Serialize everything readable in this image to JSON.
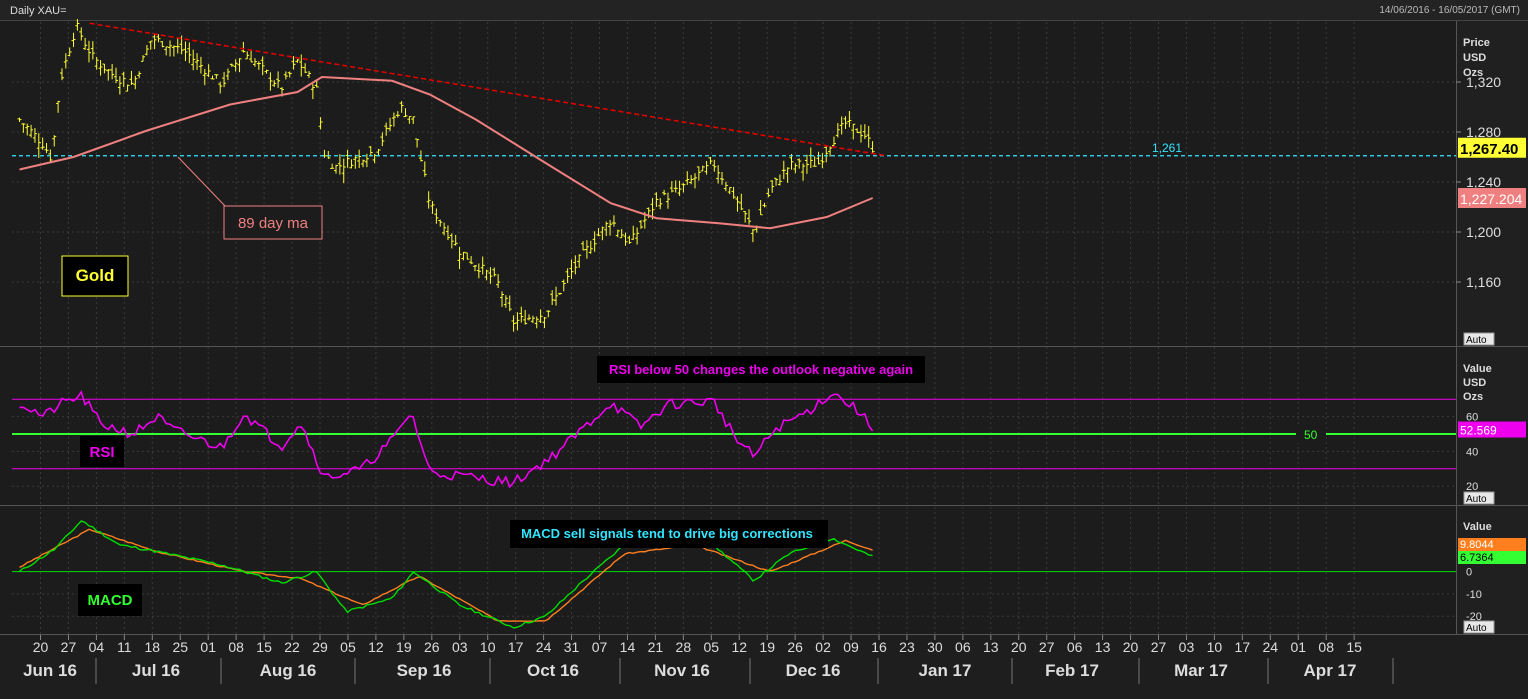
{
  "header": {
    "left_title": "Daily XAU=",
    "right_range": "14/06/2016 - 16/05/2017 (GMT)"
  },
  "colors": {
    "background": "#1c1c1c",
    "grid": "#3a3a3a",
    "price_bars": "#ffff33",
    "moving_average": "#f08080",
    "trendline": "#e00000",
    "support_line": "#33e5ff",
    "rsi_line": "#ee00ee",
    "rsi_fifty": "#33ff33",
    "macd_line": "#00dd00",
    "signal_line": "#ff7f1f"
  },
  "x_axis": {
    "day_ticks": [
      "20",
      "27",
      "04",
      "11",
      "18",
      "25",
      "01",
      "08",
      "15",
      "22",
      "29",
      "05",
      "12",
      "19",
      "26",
      "03",
      "10",
      "17",
      "24",
      "31",
      "07",
      "14",
      "21",
      "28",
      "05",
      "12",
      "19",
      "26",
      "02",
      "09",
      "16",
      "23",
      "30",
      "06",
      "13",
      "20",
      "27",
      "06",
      "13",
      "20",
      "27",
      "03",
      "10",
      "17",
      "24",
      "01",
      "08",
      "15"
    ],
    "month_labels": [
      "Jun 16",
      "Jul 16",
      "Aug 16",
      "Sep 16",
      "Oct 16",
      "Nov 16",
      "Dec 16",
      "Jan 17",
      "Feb 17",
      "Mar 17",
      "Apr 17"
    ]
  },
  "price_panel": {
    "axis_title": [
      "Price",
      "USD",
      "Ozs"
    ],
    "y_tick_labels": [
      "1,320",
      "1,280",
      "1,240",
      "1,200",
      "1,160"
    ],
    "last_price_tag": "1,267.40",
    "ma_value_tag": "1,227.204",
    "support_label": "1,261",
    "ma_annotation": "89 day ma",
    "asset_label": "Gold",
    "auto_button": "Auto"
  },
  "rsi_panel": {
    "axis_title": [
      "Value",
      "USD",
      "Ozs"
    ],
    "y_tick_labels": [
      "60",
      "40",
      "20"
    ],
    "value_tag": "52.569",
    "fifty_label": "50",
    "annotation": "RSI below 50 changes the outlook negative again",
    "panel_label": "RSI",
    "auto_button": "Auto"
  },
  "macd_panel": {
    "axis_title": "Value",
    "y_tick_labels": [
      "0",
      "-10",
      "-20"
    ],
    "macd_tag": "9.8044",
    "signal_tag": "6.7364",
    "annotation": "MACD sell signals tend to drive big corrections",
    "panel_label": "MACD",
    "auto_button": "Auto"
  },
  "chart_data": [
    {
      "type": "ohlc",
      "title": "Daily XAU=",
      "ylabel": "Price USD Ozs",
      "ylim": [
        1112,
        1364
      ],
      "approx_close_path": [
        {
          "date": "2016-06-15",
          "value": 1290
        },
        {
          "date": "2016-06-24",
          "value": 1270
        },
        {
          "date": "2016-06-27",
          "value": 1258
        },
        {
          "date": "2016-06-30",
          "value": 1320
        },
        {
          "date": "2016-07-06",
          "value": 1365
        },
        {
          "date": "2016-07-12",
          "value": 1340
        },
        {
          "date": "2016-07-20",
          "value": 1325
        },
        {
          "date": "2016-07-27",
          "value": 1318
        },
        {
          "date": "2016-08-03",
          "value": 1355
        },
        {
          "date": "2016-08-15",
          "value": 1345
        },
        {
          "date": "2016-08-29",
          "value": 1318
        },
        {
          "date": "2016-09-06",
          "value": 1345
        },
        {
          "date": "2016-09-20",
          "value": 1315
        },
        {
          "date": "2016-09-26",
          "value": 1337
        },
        {
          "date": "2016-10-03",
          "value": 1315
        },
        {
          "date": "2016-10-06",
          "value": 1262
        },
        {
          "date": "2016-10-10",
          "value": 1252
        },
        {
          "date": "2016-10-25",
          "value": 1265
        },
        {
          "date": "2016-11-03",
          "value": 1300
        },
        {
          "date": "2016-11-08",
          "value": 1290
        },
        {
          "date": "2016-11-10",
          "value": 1265
        },
        {
          "date": "2016-11-14",
          "value": 1222
        },
        {
          "date": "2016-11-25",
          "value": 1185
        },
        {
          "date": "2016-12-09",
          "value": 1160
        },
        {
          "date": "2016-12-15",
          "value": 1128
        },
        {
          "date": "2016-12-27",
          "value": 1135
        },
        {
          "date": "2017-01-09",
          "value": 1180
        },
        {
          "date": "2017-01-20",
          "value": 1210
        },
        {
          "date": "2017-01-27",
          "value": 1190
        },
        {
          "date": "2017-02-06",
          "value": 1225
        },
        {
          "date": "2017-02-14",
          "value": 1233
        },
        {
          "date": "2017-02-27",
          "value": 1255
        },
        {
          "date": "2017-03-07",
          "value": 1228
        },
        {
          "date": "2017-03-14",
          "value": 1200
        },
        {
          "date": "2017-03-20",
          "value": 1233
        },
        {
          "date": "2017-03-27",
          "value": 1253
        },
        {
          "date": "2017-04-07",
          "value": 1255
        },
        {
          "date": "2017-04-11",
          "value": 1270
        },
        {
          "date": "2017-04-17",
          "value": 1287
        },
        {
          "date": "2017-04-24",
          "value": 1278
        },
        {
          "date": "2017-04-27",
          "value": 1267.4
        }
      ],
      "moving_average_89": [
        {
          "date": "2016-06-15",
          "value": 1250
        },
        {
          "date": "2016-07-05",
          "value": 1260
        },
        {
          "date": "2016-08-01",
          "value": 1281
        },
        {
          "date": "2016-09-01",
          "value": 1302
        },
        {
          "date": "2016-09-26",
          "value": 1312
        },
        {
          "date": "2016-10-05",
          "value": 1324
        },
        {
          "date": "2016-10-31",
          "value": 1321
        },
        {
          "date": "2016-11-14",
          "value": 1310
        },
        {
          "date": "2016-12-01",
          "value": 1290
        },
        {
          "date": "2016-12-27",
          "value": 1255
        },
        {
          "date": "2017-01-20",
          "value": 1223
        },
        {
          "date": "2017-02-06",
          "value": 1211
        },
        {
          "date": "2017-03-01",
          "value": 1207
        },
        {
          "date": "2017-03-20",
          "value": 1203
        },
        {
          "date": "2017-04-10",
          "value": 1212
        },
        {
          "date": "2017-04-27",
          "value": 1227.2
        }
      ],
      "trendline": [
        {
          "date": "2016-07-11",
          "value": 1367
        },
        {
          "date": "2017-05-02",
          "value": 1261
        }
      ],
      "support_level": 1261,
      "last_value": 1267.4,
      "ma_last_value": 1227.204
    },
    {
      "type": "line",
      "title": "RSI below 50 changes the outlook negative again",
      "ylim": [
        0,
        100
      ],
      "reference_lines": [
        70,
        50,
        30
      ],
      "series": [
        {
          "name": "RSI",
          "values": [
            {
              "date": "2016-06-15",
              "value": 68
            },
            {
              "date": "2016-06-24",
              "value": 60
            },
            {
              "date": "2016-06-30",
              "value": 67
            },
            {
              "date": "2016-07-08",
              "value": 72
            },
            {
              "date": "2016-07-15",
              "value": 56
            },
            {
              "date": "2016-07-27",
              "value": 50
            },
            {
              "date": "2016-08-05",
              "value": 60
            },
            {
              "date": "2016-08-10",
              "value": 53
            },
            {
              "date": "2016-08-29",
              "value": 42
            },
            {
              "date": "2016-09-06",
              "value": 62
            },
            {
              "date": "2016-09-20",
              "value": 43
            },
            {
              "date": "2016-09-27",
              "value": 57
            },
            {
              "date": "2016-10-06",
              "value": 25
            },
            {
              "date": "2016-10-20",
              "value": 30
            },
            {
              "date": "2016-11-01",
              "value": 48
            },
            {
              "date": "2016-11-07",
              "value": 63
            },
            {
              "date": "2016-11-14",
              "value": 28
            },
            {
              "date": "2016-11-25",
              "value": 26
            },
            {
              "date": "2016-12-15",
              "value": 22
            },
            {
              "date": "2016-12-30",
              "value": 38
            },
            {
              "date": "2017-01-09",
              "value": 52
            },
            {
              "date": "2017-01-20",
              "value": 68
            },
            {
              "date": "2017-01-31",
              "value": 54
            },
            {
              "date": "2017-02-10",
              "value": 67
            },
            {
              "date": "2017-02-27",
              "value": 69
            },
            {
              "date": "2017-03-08",
              "value": 46
            },
            {
              "date": "2017-03-14",
              "value": 37
            },
            {
              "date": "2017-03-22",
              "value": 53
            },
            {
              "date": "2017-04-03",
              "value": 63
            },
            {
              "date": "2017-04-12",
              "value": 74
            },
            {
              "date": "2017-04-22",
              "value": 63
            },
            {
              "date": "2017-04-27",
              "value": 52.569
            }
          ]
        }
      ],
      "last_value": 52.569
    },
    {
      "type": "line",
      "title": "MACD sell signals tend to drive big corrections",
      "ylim": [
        -28,
        25
      ],
      "series": [
        {
          "name": "MACD",
          "values": [
            {
              "date": "2016-06-15",
              "value": 0
            },
            {
              "date": "2016-06-28",
              "value": 10
            },
            {
              "date": "2016-07-08",
              "value": 23
            },
            {
              "date": "2016-07-22",
              "value": 12
            },
            {
              "date": "2016-08-01",
              "value": 10
            },
            {
              "date": "2016-08-29",
              "value": 3
            },
            {
              "date": "2016-09-20",
              "value": -5
            },
            {
              "date": "2016-10-03",
              "value": 0
            },
            {
              "date": "2016-10-14",
              "value": -18
            },
            {
              "date": "2016-10-31",
              "value": -12
            },
            {
              "date": "2016-11-08",
              "value": 0
            },
            {
              "date": "2016-11-25",
              "value": -15
            },
            {
              "date": "2016-12-15",
              "value": -25
            },
            {
              "date": "2016-12-27",
              "value": -20
            },
            {
              "date": "2017-01-09",
              "value": -5
            },
            {
              "date": "2017-01-25",
              "value": 12
            },
            {
              "date": "2017-02-10",
              "value": 13
            },
            {
              "date": "2017-02-27",
              "value": 12
            },
            {
              "date": "2017-03-14",
              "value": -4
            },
            {
              "date": "2017-03-27",
              "value": 8
            },
            {
              "date": "2017-04-12",
              "value": 15
            },
            {
              "date": "2017-04-27",
              "value": 6.7364
            }
          ]
        },
        {
          "name": "Signal",
          "values": [
            {
              "date": "2016-06-15",
              "value": 2
            },
            {
              "date": "2016-07-11",
              "value": 19
            },
            {
              "date": "2016-08-05",
              "value": 9
            },
            {
              "date": "2016-09-06",
              "value": 0
            },
            {
              "date": "2016-09-27",
              "value": -3
            },
            {
              "date": "2016-10-20",
              "value": -15
            },
            {
              "date": "2016-11-10",
              "value": -2
            },
            {
              "date": "2016-12-09",
              "value": -22
            },
            {
              "date": "2016-12-27",
              "value": -22
            },
            {
              "date": "2017-01-25",
              "value": 8
            },
            {
              "date": "2017-02-20",
              "value": 12
            },
            {
              "date": "2017-03-20",
              "value": 0
            },
            {
              "date": "2017-04-17",
              "value": 14
            },
            {
              "date": "2017-04-27",
              "value": 9.8044
            }
          ]
        }
      ],
      "last_values": {
        "MACD": 6.7364,
        "Signal": 9.8044
      }
    }
  ]
}
